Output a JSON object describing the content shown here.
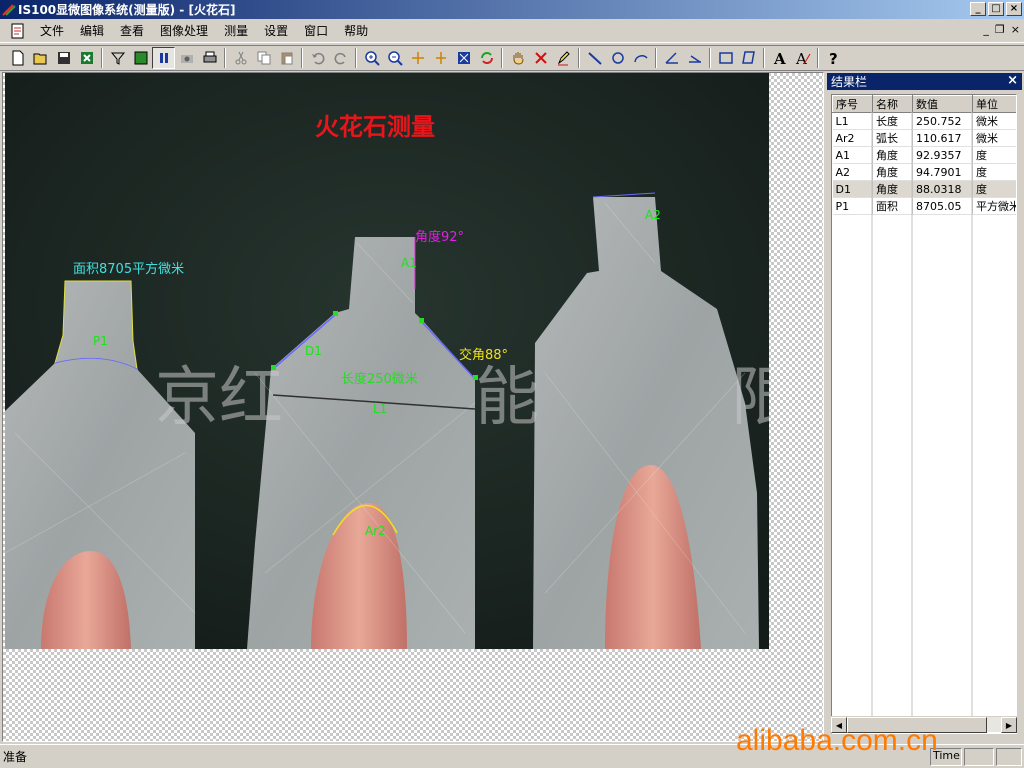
{
  "window": {
    "title": "IS100显微图像系统(测量版) - [火花石]",
    "controls": [
      "_",
      "□",
      "×"
    ]
  },
  "menu": {
    "items": [
      "文件",
      "编辑",
      "查看",
      "图像处理",
      "测量",
      "设置",
      "窗口",
      "帮助"
    ],
    "mdi_controls": [
      "_",
      "❐",
      "×"
    ]
  },
  "toolbar": {
    "icons": [
      "new-icon",
      "open-icon",
      "save-icon",
      "export-excel-icon",
      "filter-icon",
      "film-icon",
      "pause-icon",
      "camera-icon",
      "print-icon",
      "cut-icon",
      "copy-icon",
      "paste-icon",
      "undo-icon",
      "redo-icon",
      "zoom-in-icon",
      "zoom-out-icon",
      "horizontal-fit-icon",
      "vertical-fit-icon",
      "fit-window-icon",
      "refresh-icon",
      "hand-icon",
      "delete-icon",
      "pen-icon",
      "line-icon",
      "circle-icon",
      "arc-icon",
      "angle-icon",
      "intersect-angle-icon",
      "rectangle-icon",
      "polygon-icon",
      "text-icon",
      "text-style-icon",
      "help-icon"
    ]
  },
  "image": {
    "title": "火花石测量",
    "annotations": {
      "area": "面积8705平方微米",
      "p1": "P1",
      "angle_a1": "角度92°",
      "a1": "A1",
      "a2": "A2",
      "d1": "D1",
      "cross_angle": "交角88°",
      "length": "长度250微米",
      "l1": "L1",
      "ar2": "Ar2"
    },
    "watermark": "京红　　　能　　　限公司"
  },
  "results": {
    "title": "结果栏",
    "columns": [
      "序号",
      "名称",
      "数值",
      "单位"
    ],
    "rows": [
      [
        "L1",
        "长度",
        "250.752",
        "微米"
      ],
      [
        "Ar2",
        "弧长",
        "110.617",
        "微米"
      ],
      [
        "A1",
        "角度",
        "92.9357",
        "度"
      ],
      [
        "A2",
        "角度",
        "94.7901",
        "度"
      ],
      [
        "D1",
        "角度",
        "88.0318",
        "度"
      ],
      [
        "P1",
        "面积",
        "8705.05",
        "平方微米"
      ]
    ],
    "selected_row": 4
  },
  "status": {
    "text": "准备",
    "time_label": "Time"
  },
  "site_watermark": "alibaba.com.cn",
  "colors": {
    "title_red": "#e8151a",
    "measure_green": "#20e020",
    "angle_magenta": "#e020e0",
    "area_cyan": "#40e0e0",
    "yellow": "#f0e020"
  }
}
